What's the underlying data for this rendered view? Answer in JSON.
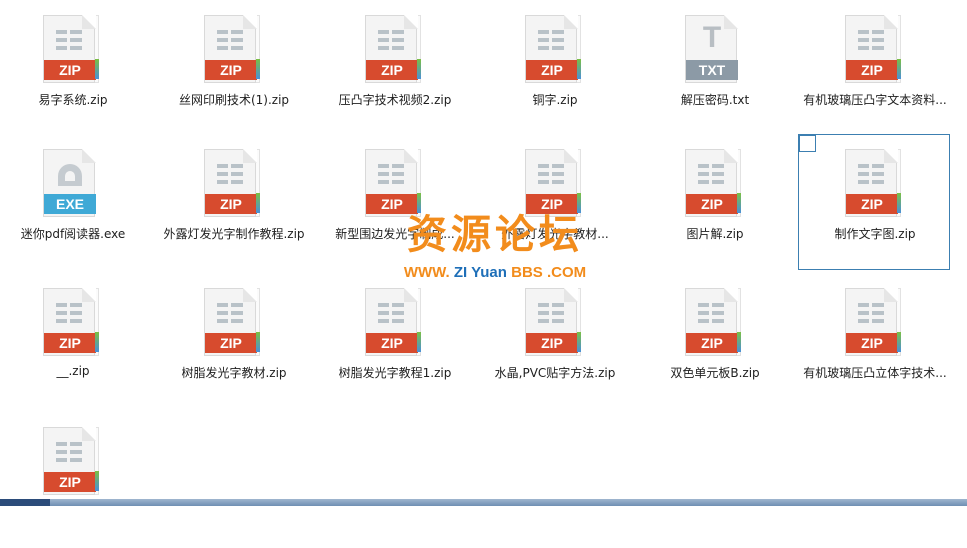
{
  "files": [
    {
      "name": "易字系统.zip",
      "type": "ZIP",
      "selected": false
    },
    {
      "name": "丝网印刷技术(1).zip",
      "type": "ZIP",
      "selected": false
    },
    {
      "name": "压凸字技术视频2.zip",
      "type": "ZIP",
      "selected": false
    },
    {
      "name": "铜字.zip",
      "type": "ZIP",
      "selected": false
    },
    {
      "name": "解压密码.txt",
      "type": "TXT",
      "selected": false
    },
    {
      "name": "有机玻璃压凸字文本资料...",
      "type": "ZIP",
      "selected": false
    },
    {
      "name": "迷你pdf阅读器.exe",
      "type": "EXE",
      "selected": false
    },
    {
      "name": "外露灯发光字制作教程.zip",
      "type": "ZIP",
      "selected": false
    },
    {
      "name": "新型围边发光字制成...",
      "type": "ZIP",
      "selected": false
    },
    {
      "name": "外露灯发光字教材...",
      "type": "ZIP",
      "selected": false
    },
    {
      "name": "图片解.zip",
      "type": "ZIP",
      "selected": false
    },
    {
      "name": "制作文字图.zip",
      "type": "ZIP",
      "selected": true
    },
    {
      "name": "__.zip",
      "type": "ZIP",
      "selected": false
    },
    {
      "name": "树脂发光字教材.zip",
      "type": "ZIP",
      "selected": false
    },
    {
      "name": "树脂发光字教程1.zip",
      "type": "ZIP",
      "selected": false
    },
    {
      "name": "水晶,PVC贴字方法.zip",
      "type": "ZIP",
      "selected": false
    },
    {
      "name": "双色单元板B.zip",
      "type": "ZIP",
      "selected": false
    },
    {
      "name": "有机玻璃压凸立体字技术...",
      "type": "ZIP",
      "selected": false
    },
    {
      "name": "",
      "type": "ZIP",
      "selected": false
    }
  ],
  "watermark": {
    "title": "资源论坛",
    "sub_www": "WWW.",
    "sub_zi": "ZI",
    "sub_yuan": "Yuan",
    "sub_bbs": "BBS",
    "sub_com": ".COM"
  },
  "colors": {
    "zip_band": "#d74b2e",
    "exe_band": "#3fa9d6",
    "txt_band": "#8c9aa6",
    "selection": "#3c7fb1",
    "watermark_orange": "#f28c1c",
    "watermark_blue": "#1e6fb8"
  }
}
